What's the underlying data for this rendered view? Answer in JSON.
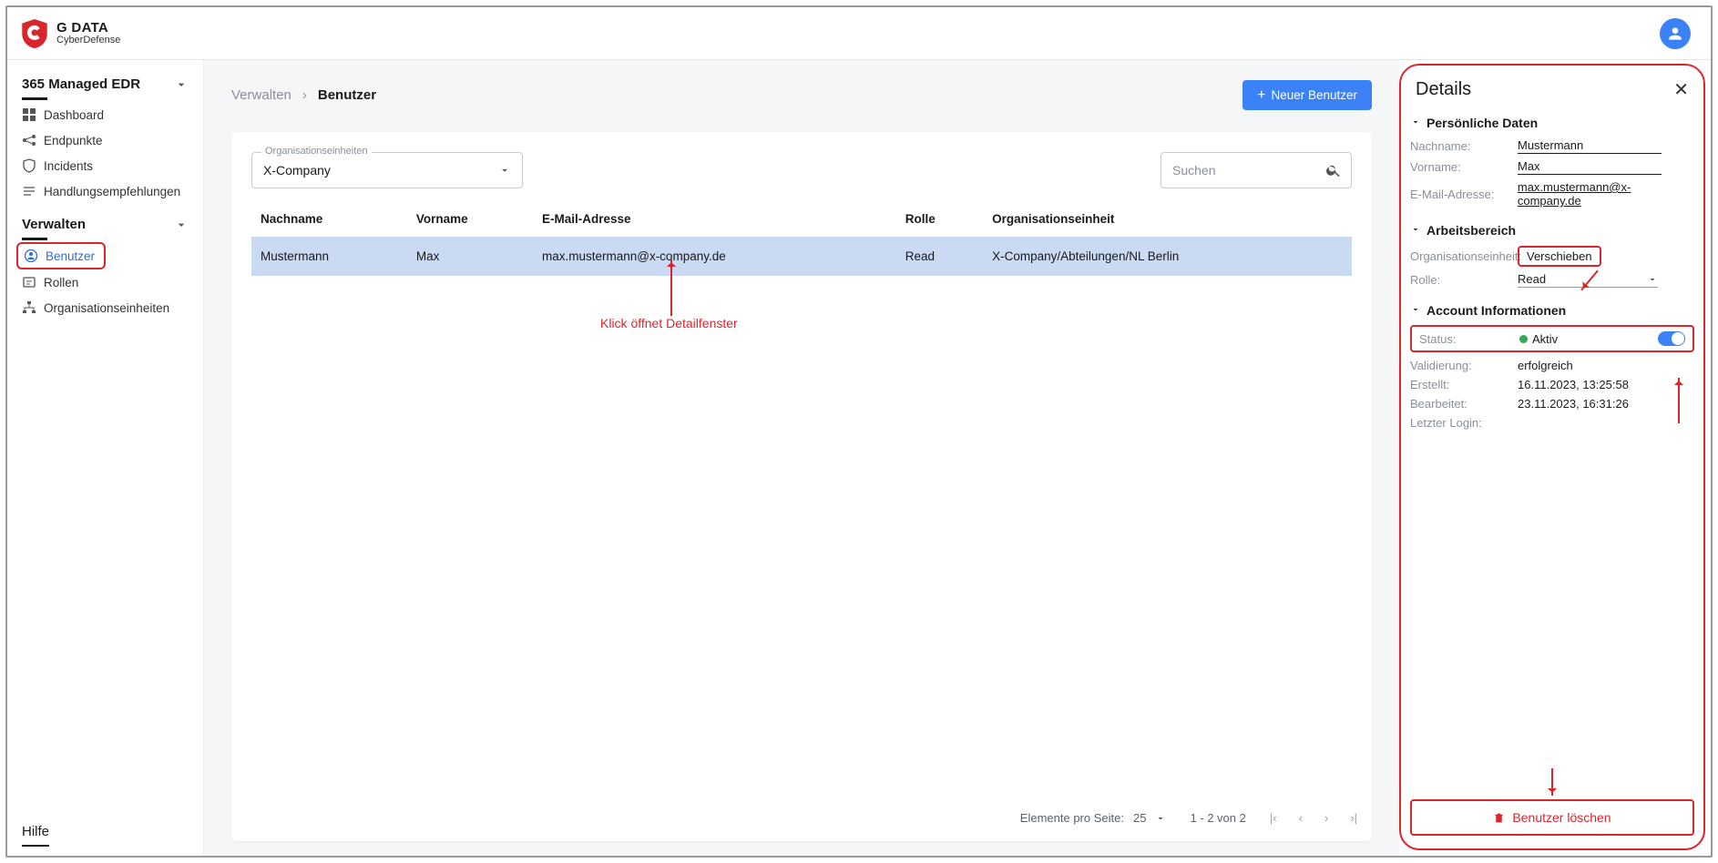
{
  "brand": {
    "line1": "G DATA",
    "line2": "CyberDefense"
  },
  "sidebar": {
    "product": "365 Managed EDR",
    "items_main": [
      {
        "icon": "dashboard-icon",
        "label": "Dashboard"
      },
      {
        "icon": "endpoints-icon",
        "label": "Endpunkte"
      },
      {
        "icon": "incidents-icon",
        "label": "Incidents"
      },
      {
        "icon": "recommendations-icon",
        "label": "Handlungsempfehlungen"
      }
    ],
    "manage_title": "Verwalten",
    "items_manage": [
      {
        "icon": "user-icon",
        "label": "Benutzer",
        "active": true
      },
      {
        "icon": "roles-icon",
        "label": "Rollen"
      },
      {
        "icon": "orgunits-icon",
        "label": "Organisationseinheiten"
      }
    ],
    "help": "Hilfe"
  },
  "breadcrumb": {
    "root": "Verwalten",
    "current": "Benutzer"
  },
  "actions": {
    "new_user": "Neuer Benutzer"
  },
  "filters": {
    "org_label": "Organisationseinheiten",
    "org_selected": "X-Company",
    "search_placeholder": "Suchen"
  },
  "table": {
    "columns": [
      "Nachname",
      "Vorname",
      "E-Mail-Adresse",
      "Rolle",
      "Organisationseinheit"
    ],
    "rows": [
      {
        "nachname": "Mustermann",
        "vorname": "Max",
        "email": "max.mustermann@x-company.de",
        "rolle": "Read",
        "org": "X-Company/Abteilungen/NL Berlin"
      }
    ]
  },
  "annotation_click": "Klick öffnet Detailfenster",
  "pager": {
    "per_page_label": "Elemente pro Seite:",
    "per_page_value": "25",
    "range": "1 - 2 von 2"
  },
  "details": {
    "title": "Details",
    "sections": {
      "personal": {
        "title": "Persönliche Daten",
        "nachname_label": "Nachname:",
        "nachname": "Mustermann",
        "vorname_label": "Vorname:",
        "vorname": "Max",
        "email_label": "E-Mail-Adresse:",
        "email": "max.mustermann@x-company.de"
      },
      "workspace": {
        "title": "Arbeitsbereich",
        "org_label": "Organisationseinheit:",
        "move_label": "Verschieben",
        "role_label": "Rolle:",
        "role_value": "Read"
      },
      "account": {
        "title": "Account Informationen",
        "status_label": "Status:",
        "status_value": "Aktiv",
        "validation_label": "Validierung:",
        "validation_value": "erfolgreich",
        "created_label": "Erstellt:",
        "created_value": "16.11.2023, 13:25:58",
        "edited_label": "Bearbeitet:",
        "edited_value": "23.11.2023, 16:31:26",
        "lastlogin_label": "Letzter Login:",
        "lastlogin_value": ""
      }
    },
    "delete_label": "Benutzer löschen"
  }
}
